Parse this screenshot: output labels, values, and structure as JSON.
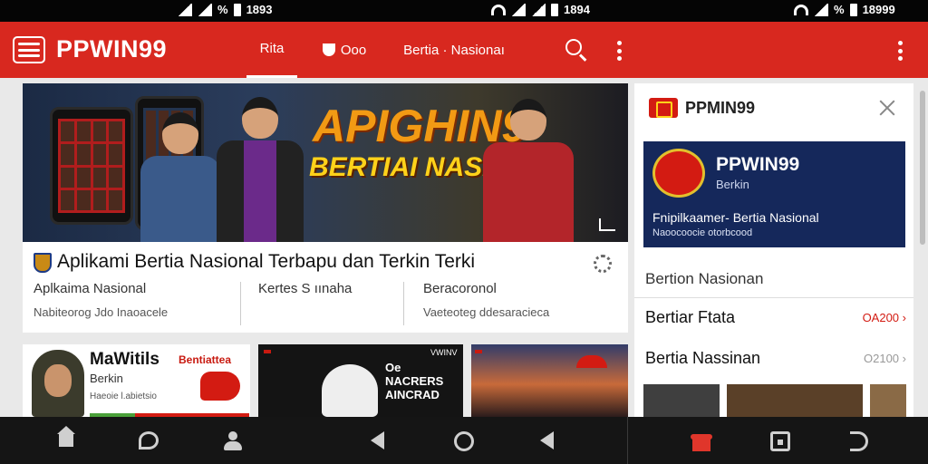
{
  "status_bar": {
    "left_time": "1893",
    "middle_time": "1894",
    "right_time": "18999",
    "battery_left": "%",
    "battery_right": "%"
  },
  "app_bar": {
    "brand": "PPWIN99",
    "tabs": [
      {
        "label": "Rita"
      },
      {
        "label": "Ooo"
      },
      {
        "label": "Bertia · Nasionaı"
      }
    ],
    "colors": {
      "primary": "#d8281f",
      "text": "#ffffff"
    }
  },
  "banner": {
    "title": "APIGHIN9",
    "subtitle": "BERTIAI NASIONAI"
  },
  "article": {
    "title": "Aplikami Bertia Nasional Terbapu dan Terkin Terki",
    "columns": [
      {
        "primary": "Aplkaima Nasional",
        "secondary": "Nabiteorog Jdo Inaoacele"
      },
      {
        "primary": "Kertes S ıınaha",
        "secondary": ""
      },
      {
        "primary": "Beracoronol",
        "secondary": "Vaeteoteg ddesaracieca"
      }
    ]
  },
  "thumbnails": [
    {
      "title": "MaWitils",
      "subtitle": "Berkin",
      "meta": "Haeoie l.abietsio",
      "logo": "Bentiattea"
    },
    {
      "label": "",
      "text": "Oe NACRERS AINCRAD",
      "views": "VWINV"
    },
    {
      "label": ""
    }
  ],
  "side_panel": {
    "brand": "PPMIN99",
    "promo": {
      "brand": "PPWIN99",
      "sub": "Berkin",
      "description": "Fnipilkaamer- Bertia Nasional",
      "description_small": "Naoocoocie otorbcood"
    },
    "section_title": "Bertion Nasionan",
    "rows": [
      {
        "label": "Bertiar Ftata",
        "value": "OA200"
      },
      {
        "label": "Bertia Nassinan",
        "value": "O2100"
      }
    ]
  },
  "icons": [
    "menu-icon",
    "search-icon",
    "kebab-icon",
    "share-icon",
    "gear-icon",
    "close-icon",
    "home-icon",
    "chat-icon",
    "user-icon",
    "back-icon",
    "circle-home-icon",
    "gift-icon",
    "square-icon",
    "undo-icon"
  ]
}
